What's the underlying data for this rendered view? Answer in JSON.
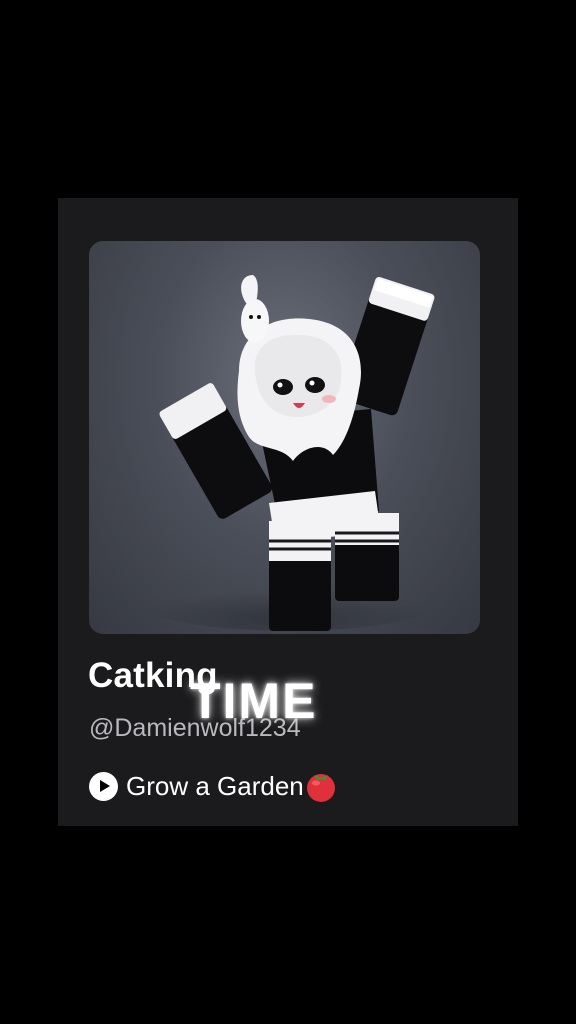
{
  "profile_card": {
    "display_name": "Catking",
    "username": "@Damienwolf1234",
    "game": {
      "label": "Grow a Garden",
      "play_icon": "play-circle-icon",
      "emoji_icon": "tomato-icon"
    }
  },
  "overlay": {
    "caption": "TIME"
  },
  "colors": {
    "background": "#000000",
    "card": "#1b1b1d",
    "text_primary": "#ffffff",
    "text_secondary": "#b8b8bd",
    "tomato": "#e0303a"
  }
}
